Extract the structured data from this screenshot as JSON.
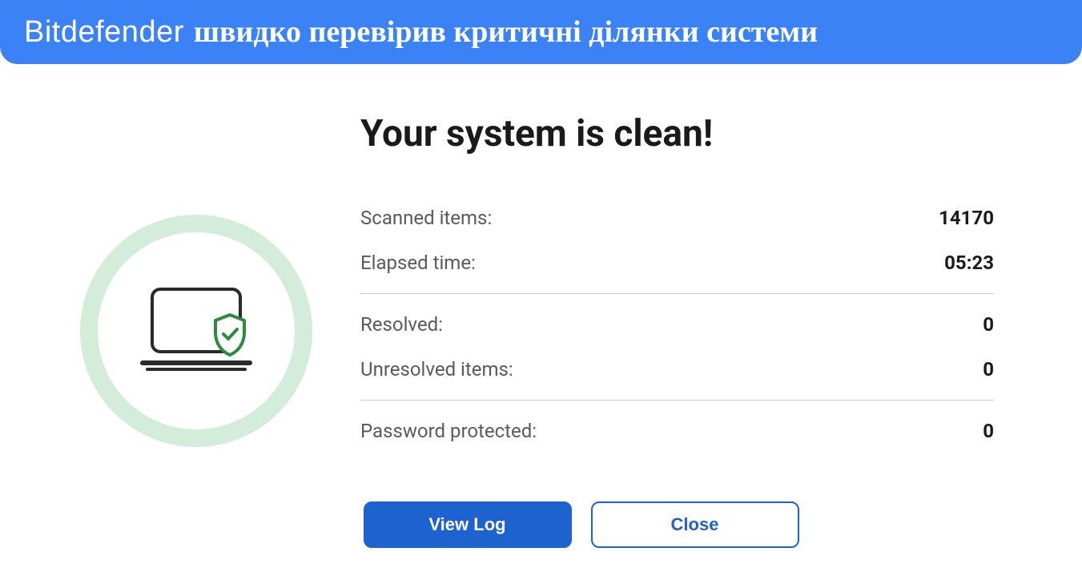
{
  "banner": {
    "brand": "Bitdefender",
    "text": "швидко перевірив критичні ділянки системи"
  },
  "main": {
    "heading": "Your system is clean!",
    "stats": {
      "scanned_items_label": "Scanned items:",
      "scanned_items_value": "14170",
      "elapsed_time_label": "Elapsed time:",
      "elapsed_time_value": "05:23",
      "resolved_label": "Resolved:",
      "resolved_value": "0",
      "unresolved_label": "Unresolved items:",
      "unresolved_value": "0",
      "password_protected_label": "Password protected:",
      "password_protected_value": "0"
    }
  },
  "buttons": {
    "view_log": "View Log",
    "close": "Close"
  }
}
